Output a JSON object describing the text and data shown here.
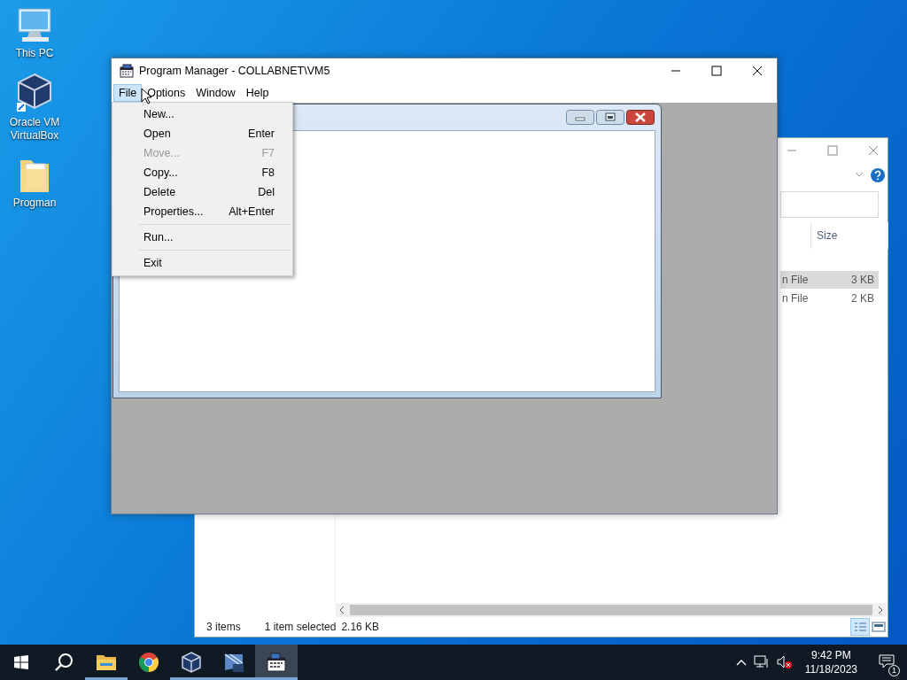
{
  "desktop_icons": [
    {
      "label": "This PC",
      "kind": "pc"
    },
    {
      "label": "Oracle VM VirtualBox",
      "kind": "vbox"
    },
    {
      "label": "Progman",
      "kind": "folder"
    }
  ],
  "explorer": {
    "column": "Size",
    "rows": [
      {
        "type": "n File",
        "size": "3 KB",
        "selected": true
      },
      {
        "type": "n File",
        "size": "2 KB",
        "selected": false
      }
    ],
    "status": {
      "items": "3 items",
      "selection": "1 item selected",
      "size": "2.16 KB"
    }
  },
  "program_manager": {
    "title": "Program Manager - COLLABNET\\VM5",
    "menu": [
      {
        "label": "File",
        "selected": true
      },
      {
        "label": "Options",
        "selected": false
      },
      {
        "label": "Window",
        "selected": false
      },
      {
        "label": "Help",
        "selected": false
      }
    ],
    "file_menu": [
      {
        "kind": "item",
        "label": "New...",
        "disabled": false
      },
      {
        "kind": "item",
        "label": "Open",
        "shortcut": "Enter",
        "disabled": false
      },
      {
        "kind": "item",
        "label": "Move...",
        "shortcut": "F7",
        "disabled": true
      },
      {
        "kind": "item",
        "label": "Copy...",
        "shortcut": "F8",
        "disabled": false
      },
      {
        "kind": "item",
        "label": "Delete",
        "shortcut": "Del",
        "disabled": false
      },
      {
        "kind": "item",
        "label": "Properties...",
        "shortcut": "Alt+Enter",
        "disabled": false
      },
      {
        "kind": "separator"
      },
      {
        "kind": "item",
        "label": "Run...",
        "disabled": false
      },
      {
        "kind": "separator"
      },
      {
        "kind": "item",
        "label": "Exit",
        "disabled": false
      }
    ]
  },
  "taskbar": {
    "apps": [
      {
        "kind": "explorer",
        "running": true,
        "selected": false
      },
      {
        "kind": "chrome",
        "running": false,
        "selected": false
      },
      {
        "kind": "vbox",
        "running": true,
        "selected": false
      },
      {
        "kind": "xp",
        "running": true,
        "selected": false
      },
      {
        "kind": "progman",
        "running": true,
        "selected": true
      }
    ],
    "time": "9:42 PM",
    "date": "11/18/2023",
    "notifications": "1"
  }
}
